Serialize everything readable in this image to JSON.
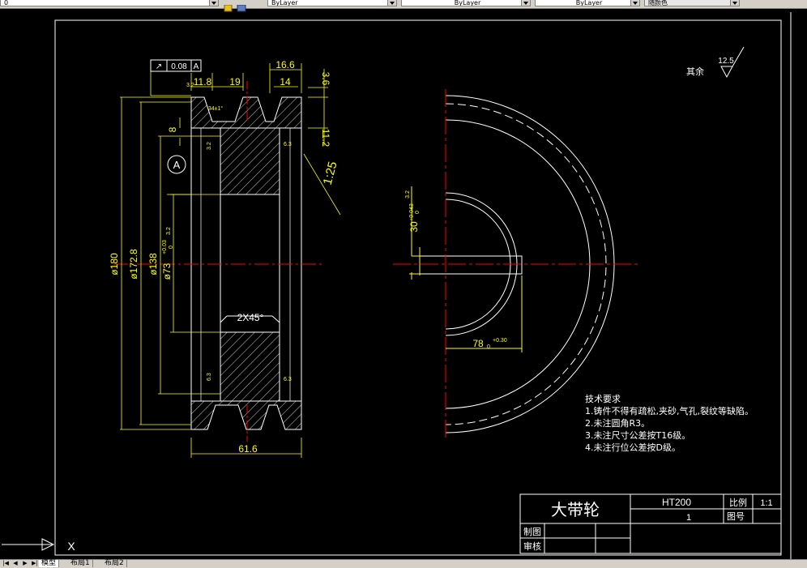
{
  "colors": {
    "background": "#000000",
    "frame": "#ffffff",
    "dimension": "#ffff00",
    "center": "#ff0000",
    "hatch": "#ffffff"
  },
  "toolbar": {
    "layer_value": "0",
    "color_value": "ByLayer",
    "linetype_value": "ByLayer",
    "lineweight_value": "ByLayer",
    "plotstyle_value": "随颜色"
  },
  "drawing": {
    "tolerance": {
      "value": "0.08",
      "datum": "A",
      "symbol": "↗"
    },
    "datum_label": "A",
    "roughness_note": "其余",
    "roughness_value": "12.5",
    "dims": {
      "d1": "11.8",
      "d2": "19",
      "d3": "16.6",
      "d4": "14",
      "d5": "3.6",
      "d6": "8",
      "d7": "11.2",
      "taper": "1:25",
      "dia180": "ø180",
      "dia172": "ø172.8",
      "dia138": "ø138",
      "dia73": "ø73",
      "dia73_tol": "+0.03",
      "dia73_tol2": "0",
      "chamfer": "2X45°",
      "width": "61.6",
      "keyway_30": "30",
      "keyway_30_tol": "+0.043",
      "keyway_30_tol2": "0",
      "keyway_78": "78",
      "keyway_78_tol": "+0.30",
      "keyway_78_tol2": "0",
      "rough_32": "3.2",
      "rough_63": "6.3",
      "angle": "34±1°"
    },
    "notes": {
      "title": "技术要求",
      "lines": [
        "1.铸件不得有疏松,夹砂,气孔,裂纹等缺陷。",
        "2.未注圆角R3。",
        "3.未注尺寸公差按T16级。",
        "4.未注行位公差按D级。"
      ]
    },
    "title_block": {
      "name": "大带轮",
      "material": "HT200",
      "scale_label": "比例",
      "scale_value": "1:1",
      "qty": "1",
      "drawing_no_label": "图号",
      "drawn_label": "制图",
      "checked_label": "审核"
    },
    "ucs_label": "X"
  },
  "tabs": {
    "model": "模型",
    "layout1": "布局1",
    "layout2": "布局2"
  }
}
